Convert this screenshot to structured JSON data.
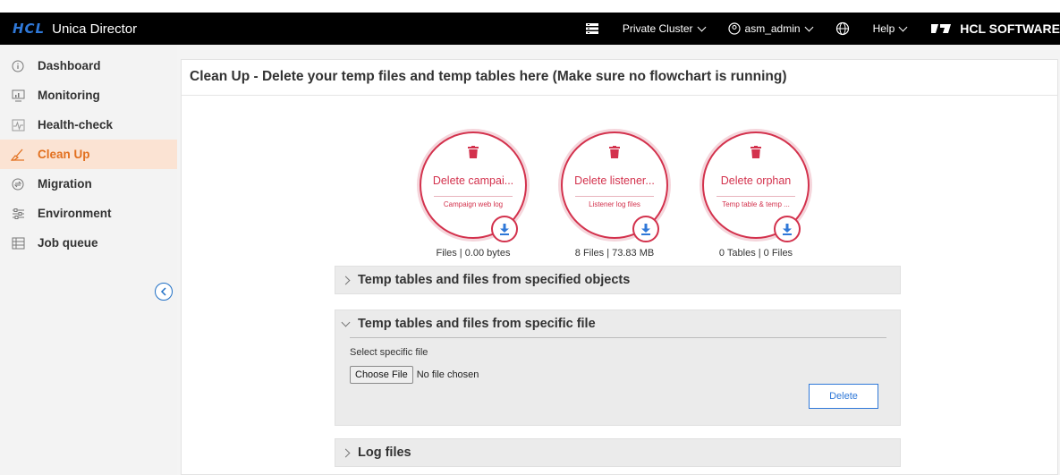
{
  "header": {
    "brand_logo": "HCL",
    "app_title": "Unica Director",
    "cluster_label": "Private Cluster",
    "user_label": "asm_admin",
    "help_label": "Help",
    "vendor_label": "HCL SOFTWARE"
  },
  "sidebar": {
    "items": [
      {
        "label": "Dashboard",
        "icon": "info-icon"
      },
      {
        "label": "Monitoring",
        "icon": "monitor-icon"
      },
      {
        "label": "Health-check",
        "icon": "heartbeat-icon"
      },
      {
        "label": "Clean Up",
        "icon": "broom-icon"
      },
      {
        "label": "Migration",
        "icon": "migration-icon"
      },
      {
        "label": "Environment",
        "icon": "sliders-icon"
      },
      {
        "label": "Job queue",
        "icon": "queue-icon"
      }
    ],
    "active_index": 3
  },
  "main": {
    "title": "Clean Up - Delete your temp files and temp tables here (Make sure no flowchart is running)",
    "cards": [
      {
        "label": "Delete campai...",
        "sublabel": "Campaign web log",
        "caption": "Files | 0.00 bytes"
      },
      {
        "label": "Delete listener...",
        "sublabel": "Listener log files",
        "caption": "8 Files | 73.83 MB"
      },
      {
        "label": "Delete orphan",
        "sublabel": "Temp table & temp ...",
        "caption": "0 Tables | 0 Files"
      }
    ],
    "accordions": {
      "specified_objects": {
        "title": "Temp tables and files from specified objects"
      },
      "specific_file": {
        "title": "Temp tables and files from specific file",
        "field_label": "Select specific file",
        "choose_label": "Choose File",
        "no_file_label": "No file chosen",
        "delete_label": "Delete"
      },
      "log_files": {
        "title": "Log files"
      }
    }
  },
  "colors": {
    "accent_red": "#d3324d",
    "accent_blue": "#2f78d8",
    "active_orange": "#e2701f"
  }
}
